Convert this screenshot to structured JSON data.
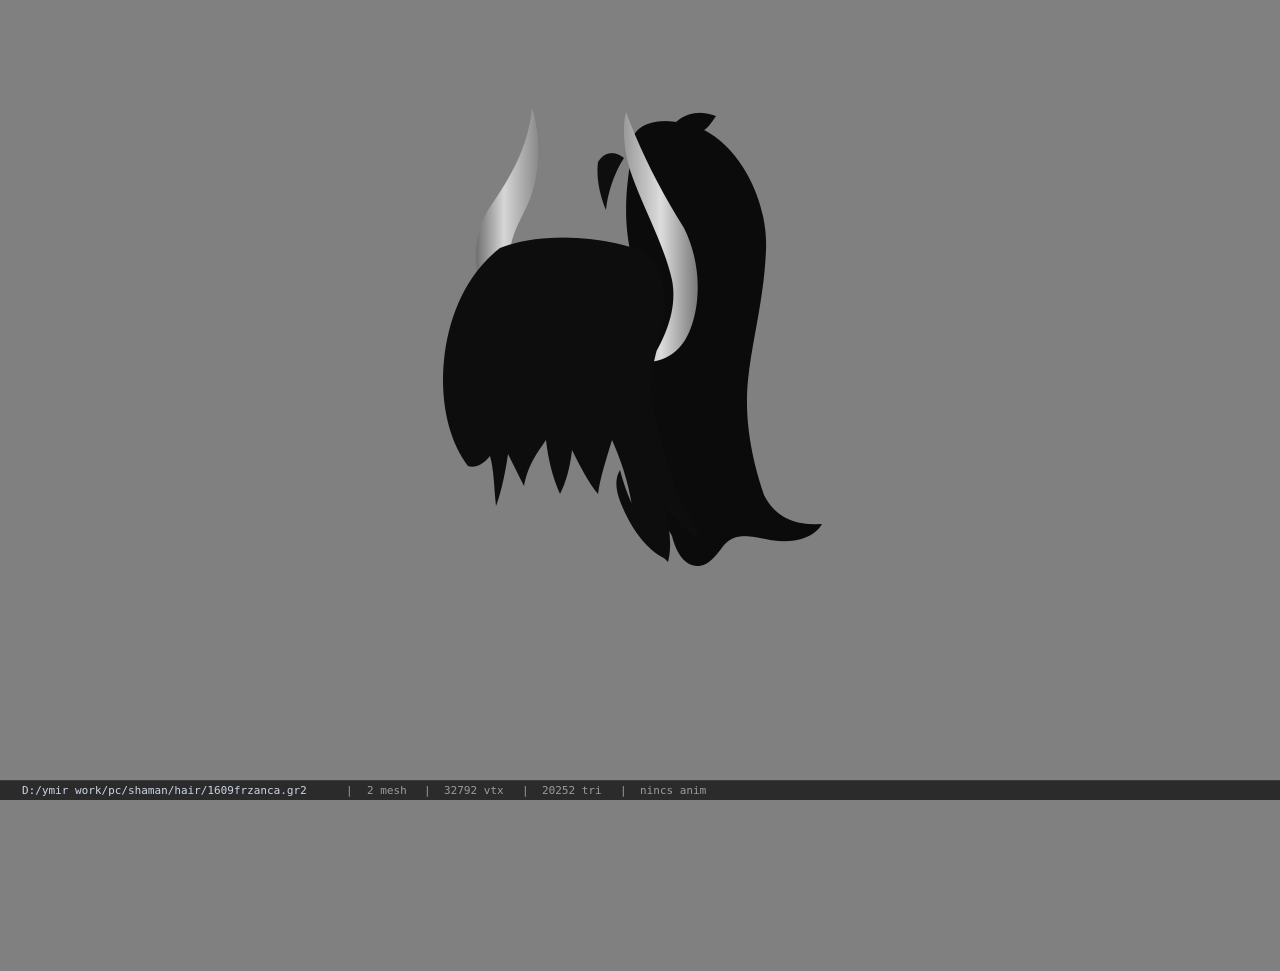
{
  "status": {
    "file_path": "D:/ymir work/pc/shaman/hair/1609frzanca.gr2",
    "separator": "|",
    "mesh": "2 mesh",
    "vertices": "32792 vtx",
    "triangles": "20252 tri",
    "animation": "nincs anim"
  },
  "viewport": {
    "background": "#808080",
    "model_color": "#0c0c0c",
    "horn_color": "#b9b9b9"
  }
}
